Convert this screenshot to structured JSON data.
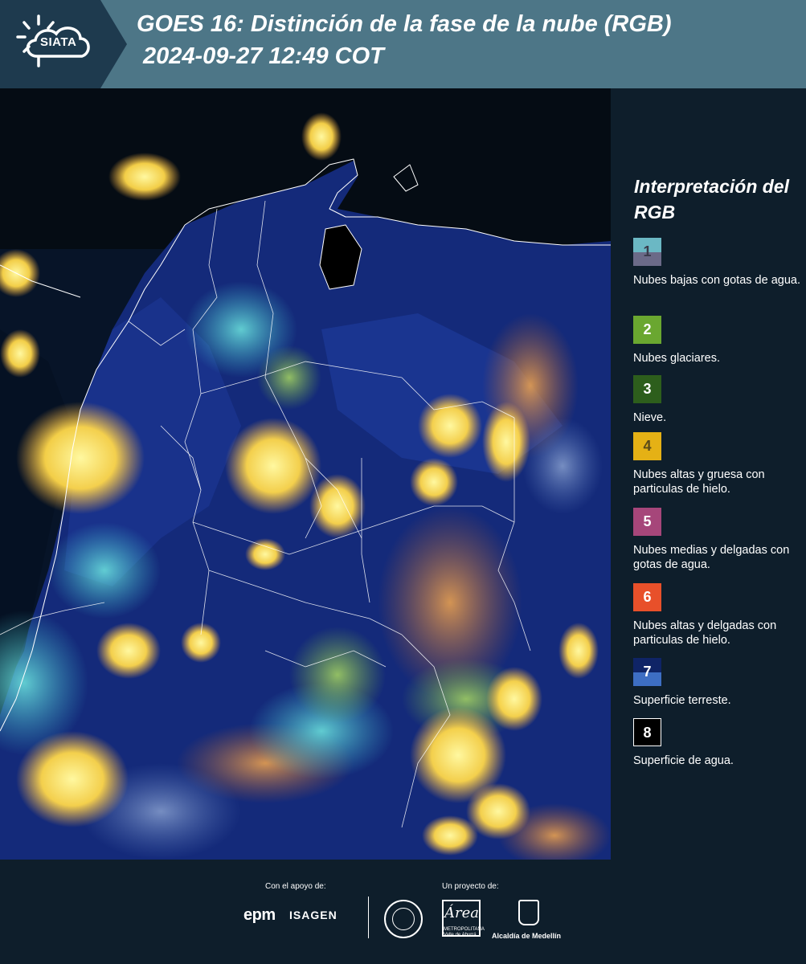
{
  "header": {
    "logo_text": "SIATA",
    "title_line1": "GOES 16: Distinción de la fase de la nube (RGB)",
    "title_line2": "2024-09-27 12:49 COT",
    "bg_color": "#4d7687",
    "logo_bg_color": "#1e3a4e"
  },
  "map": {
    "icons": [
      "satellite-rgb-image",
      "country-borders",
      "department-borders"
    ]
  },
  "legend": {
    "title": "Interpretación del RGB",
    "items": [
      {
        "number": "1",
        "label": "Nubes bajas con gotas de agua.",
        "color_top": "#6bb8c4",
        "color_bottom": "#6b6a88"
      },
      {
        "number": "2",
        "label": "Nubes glaciares.",
        "color": "#6aa730"
      },
      {
        "number": "3",
        "label": "Nieve.",
        "color": "#2d5e1c"
      },
      {
        "number": "4",
        "label": "Nubes altas y gruesa con particulas de hielo.",
        "color": "#e5b115"
      },
      {
        "number": "5",
        "label": "Nubes medias y delgadas con gotas de agua.",
        "color": "#a6467a"
      },
      {
        "number": "6",
        "label": "Nubes altas y delgadas con particulas de hielo.",
        "color": "#e8502a"
      },
      {
        "number": "7",
        "label": "Superficie terreste.",
        "color_top": "#0f2466",
        "color_bottom": "#3d6ec3"
      },
      {
        "number": "8",
        "label": "Superficie de agua.",
        "color": "#000000"
      }
    ]
  },
  "footer": {
    "support_label": "Con el apoyo de:",
    "project_label": "Un proyecto de:",
    "sponsors": [
      "epm",
      "ISAGEN"
    ],
    "epm_text": "epm",
    "isagen_text": "ISAGEN",
    "area_text": "Área",
    "area_sub1": "METROPOLITANA",
    "area_sub2": "Valle de Aburrá",
    "alcaldia_text": "Alcaldía de Medellín"
  }
}
